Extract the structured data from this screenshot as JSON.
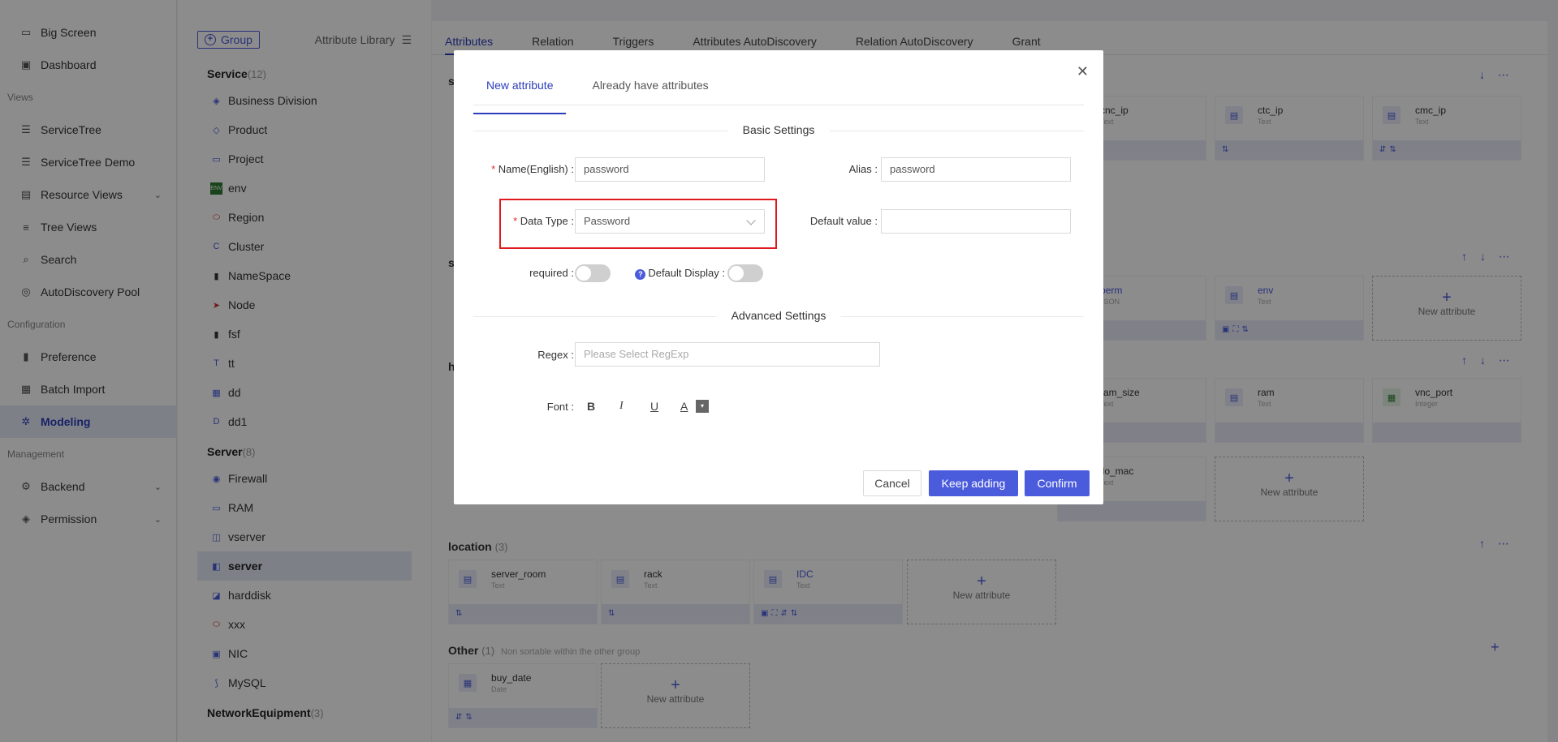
{
  "sidebar": {
    "items_top": [
      {
        "label": "Big Screen",
        "icon": "monitor-icon"
      },
      {
        "label": "Dashboard",
        "icon": "dashboard-icon"
      }
    ],
    "group_views": "Views",
    "items_views": [
      {
        "label": "ServiceTree"
      },
      {
        "label": "ServiceTree Demo"
      },
      {
        "label": "Resource Views"
      },
      {
        "label": "Tree Views"
      },
      {
        "label": "Search"
      },
      {
        "label": "AutoDiscovery Pool"
      }
    ],
    "group_configuration": "Configuration",
    "items_config": [
      {
        "label": "Preference"
      },
      {
        "label": "Batch Import"
      },
      {
        "label": "Modeling"
      }
    ],
    "group_management": "Management",
    "items_mgmt": [
      {
        "label": "Backend"
      },
      {
        "label": "Permission"
      }
    ]
  },
  "library": {
    "group_button": "Group",
    "library_label": "Attribute Library",
    "categories": [
      {
        "title": "Service",
        "count": "(12)",
        "items": [
          "Business Division",
          "Product",
          "Project",
          "env",
          "Region",
          "Cluster",
          "NameSpace",
          "Node",
          "fsf",
          "tt",
          "dd",
          "dd1"
        ]
      },
      {
        "title": "Server",
        "count": "(8)",
        "items": [
          "Firewall",
          "RAM",
          "vserver",
          "server",
          "harddisk",
          "xxx",
          "NIC",
          "MySQL"
        ]
      },
      {
        "title": "NetworkEquipment",
        "count": "(3)",
        "items": []
      }
    ]
  },
  "main": {
    "tabs": [
      "Attributes",
      "Relation",
      "Triggers",
      "Attributes AutoDiscovery",
      "Relation AutoDiscovery",
      "Grant"
    ],
    "sections": {
      "s1": "s",
      "s2": "s",
      "s3": "h",
      "location_title": "location",
      "location_count": "(3)",
      "other_title": "Other",
      "other_count": "(1)",
      "other_hint": "Non sortable within the other group"
    },
    "cards": {
      "cnc_ip": {
        "name": "cnc_ip",
        "type": "Text"
      },
      "ctc_ip": {
        "name": "ctc_ip",
        "type": "Text"
      },
      "cmc_ip": {
        "name": "cmc_ip",
        "type": "Text"
      },
      "perm": {
        "name": "perm",
        "type": "JSON"
      },
      "env": {
        "name": "env",
        "type": "Text"
      },
      "ram_size": {
        "name": "ram_size",
        "type": "Text"
      },
      "ram": {
        "name": "ram",
        "type": "Text"
      },
      "vnc_port": {
        "name": "vnc_port",
        "type": "Integer"
      },
      "ilo_mac": {
        "name": "ilo_mac",
        "type": "Text"
      },
      "server_room": {
        "name": "server_room",
        "type": "Text"
      },
      "rack": {
        "name": "rack",
        "type": "Text"
      },
      "idc": {
        "name": "IDC",
        "type": "Text"
      },
      "buy_date": {
        "name": "buy_date",
        "type": "Date"
      },
      "new_label": "New attribute"
    }
  },
  "modal": {
    "tab_new": "New attribute",
    "tab_existing": "Already have attributes",
    "basic_settings": "Basic Settings",
    "name_label": "Name(English)",
    "name_value": "password",
    "alias_label": "Alias",
    "alias_value": "password",
    "datatype_label": "Data Type",
    "datatype_value": "Password",
    "default_label": "Default value",
    "default_value": "",
    "required_label": "required",
    "default_display_label": "Default Display",
    "advanced_settings": "Advanced Settings",
    "regex_label": "Regex",
    "regex_placeholder": "Please Select RegExp",
    "font_label": "Font",
    "btn_cancel": "Cancel",
    "btn_keep": "Keep adding",
    "btn_confirm": "Confirm",
    "accent": "#4a5bdc",
    "highlight_color": "#e0191f"
  }
}
